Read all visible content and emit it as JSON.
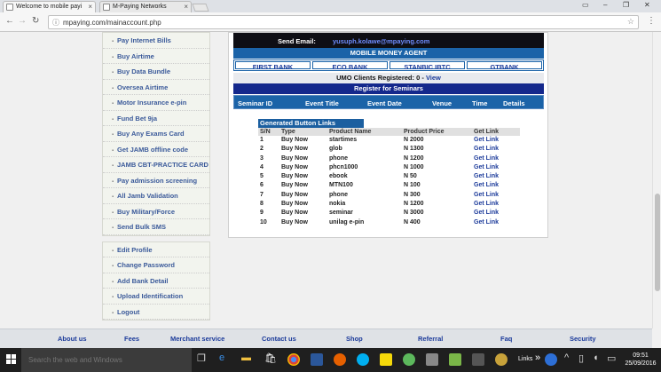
{
  "browser": {
    "tabs": [
      {
        "title": "Welcome to mobile payi",
        "active": true
      },
      {
        "title": "M-Paying Networks",
        "active": false
      }
    ],
    "url": "mpaying.com/mainaccount.php"
  },
  "top": {
    "send_email_label": "Send Email:",
    "send_email_value": "yusuph.kolawe@mpaying.com"
  },
  "agent": {
    "title": "MOBILE MONEY AGENT",
    "banks": [
      "FIRST BANK",
      "ECO BANK",
      "STANBIC IBTC",
      "GTBANK"
    ],
    "umo_text": "UMO Clients Registered: 0 - ",
    "umo_link": "View"
  },
  "seminar": {
    "title": "Register for Seminars",
    "columns": [
      "Seminar ID",
      "Event Title",
      "Event Date",
      "Venue",
      "Time",
      "Details"
    ]
  },
  "sidebar": {
    "items": [
      "Pay Internet Bills",
      "Buy Airtime",
      "Buy Data Bundle",
      "Oversea Airtime",
      "Motor Insurance e-pin",
      "Fund Bet 9ja",
      "Buy Any Exams Card",
      "Get JAMB offline code",
      "JAMB CBT-PRACTICE CARD",
      "Pay admission screening",
      "All Jamb Validation",
      "Buy Military/Force",
      "Send Bulk SMS"
    ],
    "account_items": [
      "Edit Profile",
      "Change Password",
      "Add Bank Detail",
      "Upload Identification",
      "Logout"
    ]
  },
  "generated": {
    "title": "Generated Button Links",
    "columns": [
      "S/N",
      "Type",
      "Product Name",
      "Product Price",
      "Get Link"
    ],
    "rows": [
      [
        "1",
        "Buy Now",
        "startimes",
        "N 2000",
        "Get Link"
      ],
      [
        "2",
        "Buy Now",
        "glob",
        "N 1300",
        "Get Link"
      ],
      [
        "3",
        "Buy Now",
        "phone",
        "N 1200",
        "Get Link"
      ],
      [
        "4",
        "Buy Now",
        "phcn1000",
        "N 1000",
        "Get Link"
      ],
      [
        "5",
        "Buy Now",
        "ebook",
        "N 50",
        "Get Link"
      ],
      [
        "6",
        "Buy Now",
        "MTN100",
        "N 100",
        "Get Link"
      ],
      [
        "7",
        "Buy Now",
        "phone",
        "N 300",
        "Get Link"
      ],
      [
        "8",
        "Buy Now",
        "nokia",
        "N 1200",
        "Get Link"
      ],
      [
        "9",
        "Buy Now",
        "seminar",
        "N 3000",
        "Get Link"
      ],
      [
        "10",
        "Buy Now",
        "unilag e-pin",
        "N 400",
        "Get Link"
      ]
    ]
  },
  "footer": {
    "links": [
      "About us",
      "Fees",
      "Merchant service",
      "Contact us",
      "Shop",
      "Referral",
      "Faq",
      "Security"
    ]
  },
  "taskbar": {
    "search_placeholder": "Search the web and Windows",
    "links_label": "Links",
    "time": "09:51",
    "date": "25/09/2016"
  }
}
